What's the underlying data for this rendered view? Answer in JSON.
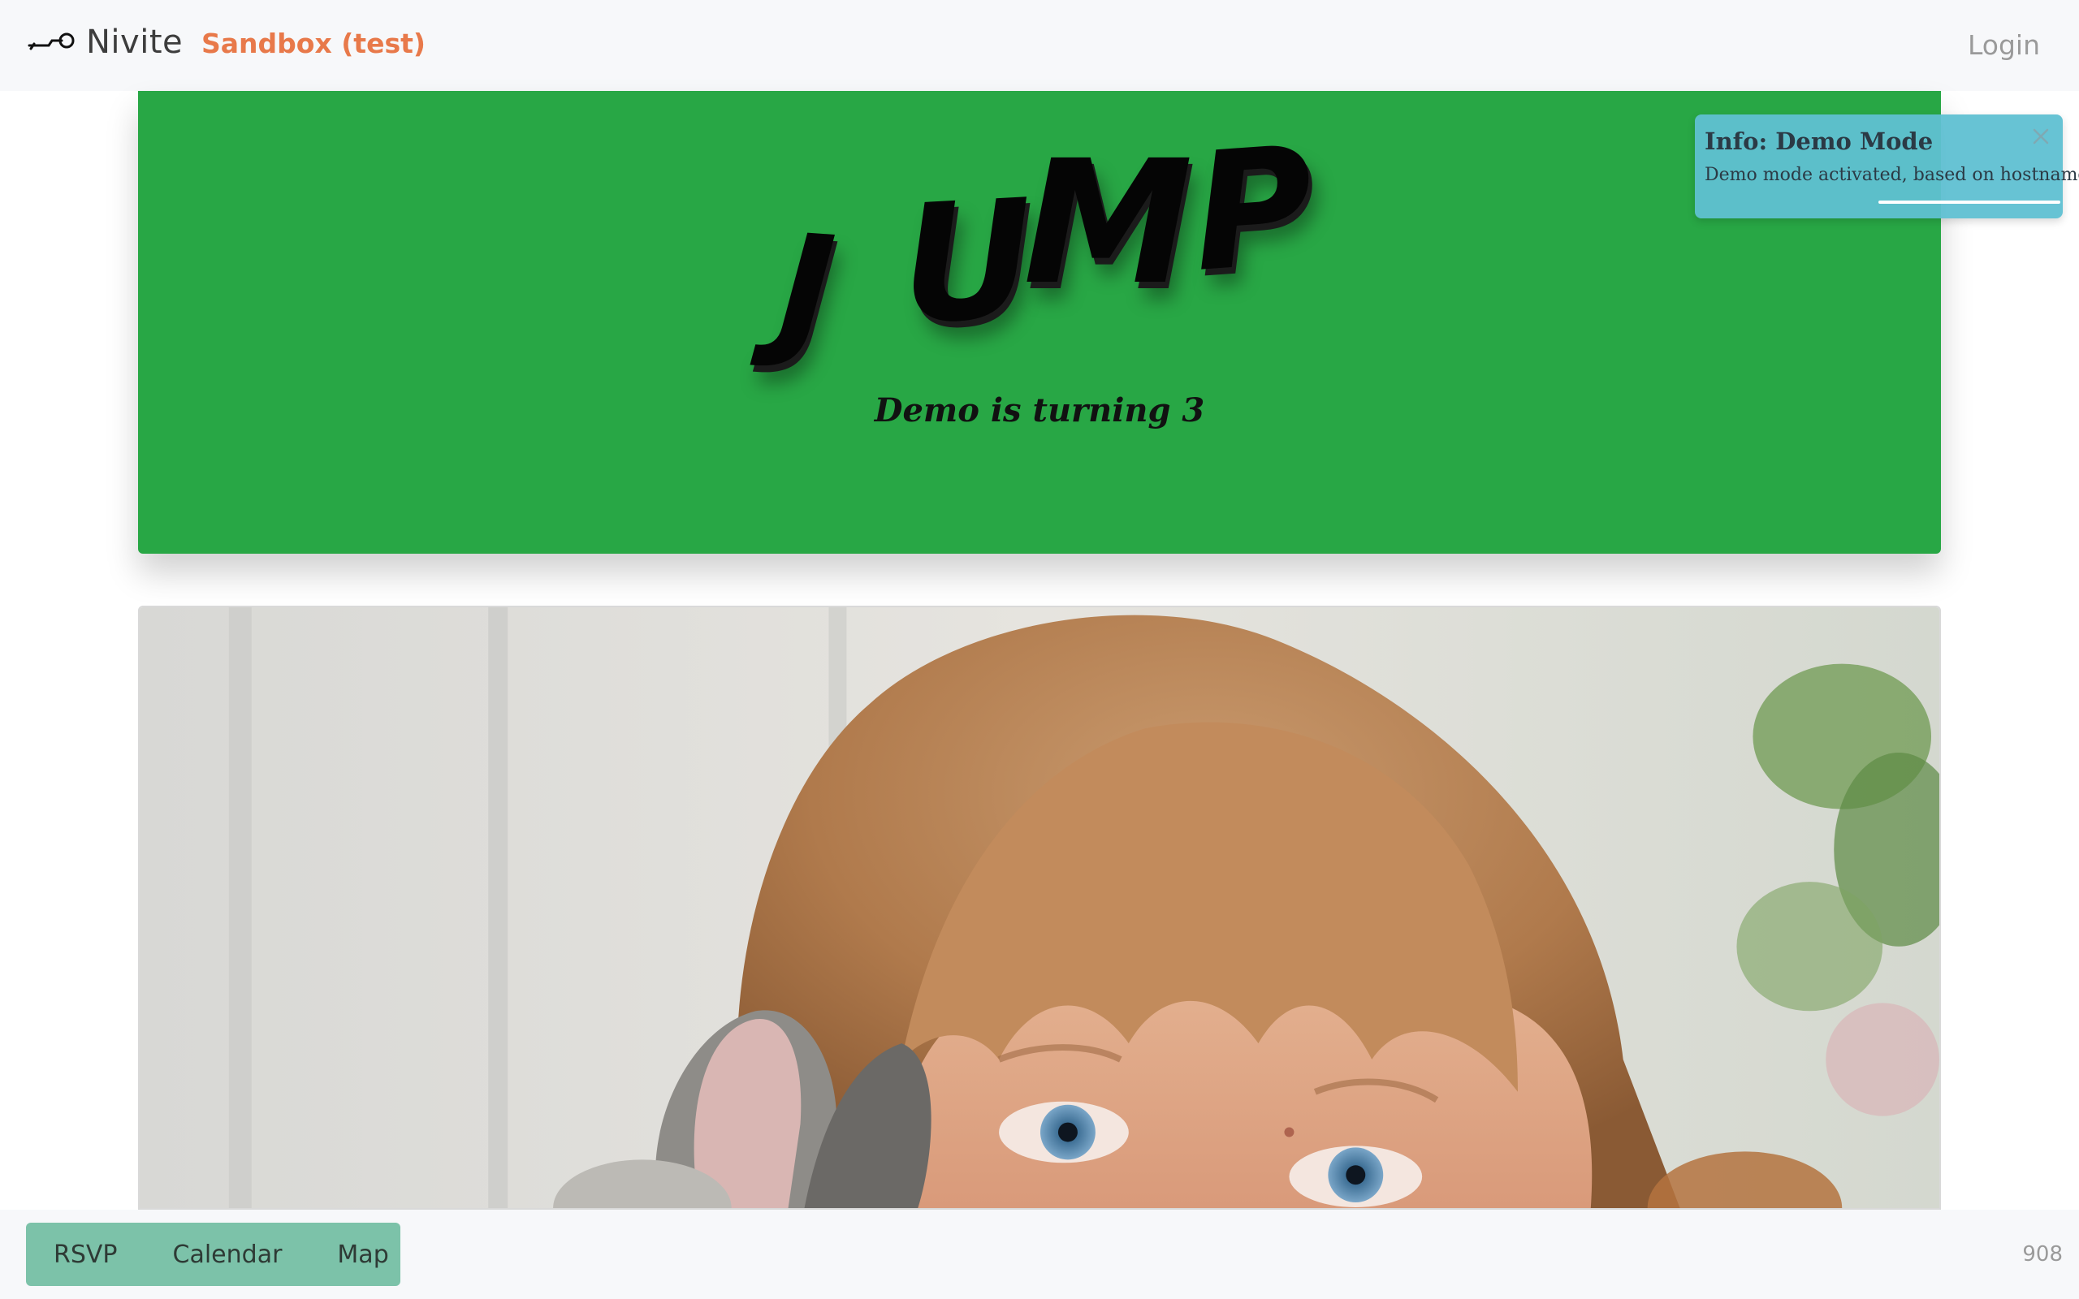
{
  "navbar": {
    "brand_name": "Nivite",
    "brand_icon": "whistle-logo-icon",
    "environment_label": "Sandbox (test)",
    "login_label": "Login"
  },
  "hero": {
    "letters": [
      "J",
      "U",
      "M",
      "P"
    ],
    "subtitle": "Demo is turning 3",
    "background_color": "#28a745"
  },
  "toast": {
    "title": "Info: Demo Mode",
    "message": "Demo mode activated, based on hostname",
    "close_icon": "close-icon",
    "progress_fraction": 0.5,
    "background_color": "#5fc0d2"
  },
  "photo": {
    "subject": "girl-with-rabbit-photo"
  },
  "bottom_nav": {
    "items": [
      {
        "label": "RSVP"
      },
      {
        "label": "Calendar"
      },
      {
        "label": "Map"
      }
    ],
    "background_color": "#7cc2a9"
  },
  "counter": "908",
  "colors": {
    "accent_orange": "#e8794a"
  }
}
